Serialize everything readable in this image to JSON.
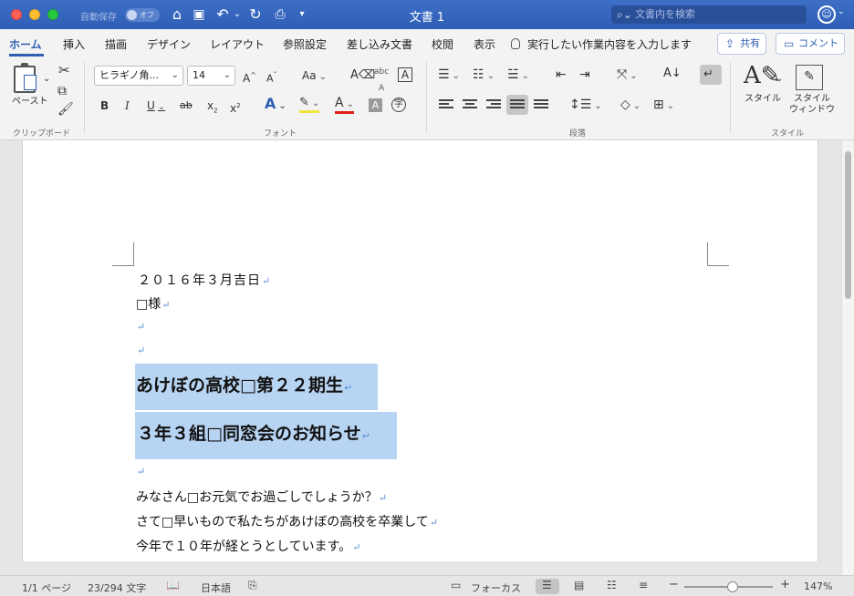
{
  "titlebar": {
    "autosave_label": "自動保存",
    "autosave_state": "オフ",
    "doc_title": "文書 1",
    "search_placeholder": "文書内を検索"
  },
  "tabs": [
    {
      "label": "ホーム",
      "active": true
    },
    {
      "label": "挿入"
    },
    {
      "label": "描画"
    },
    {
      "label": "デザイン"
    },
    {
      "label": "レイアウト"
    },
    {
      "label": "参照設定"
    },
    {
      "label": "差し込み文書"
    },
    {
      "label": "校閲"
    },
    {
      "label": "表示"
    }
  ],
  "tellme": "実行したい作業内容を入力します",
  "share_label": "共有",
  "comment_label": "コメント",
  "ribbon": {
    "paste_label": "ペースト",
    "clipboard_group": "クリップボード",
    "font_group": "フォント",
    "paragraph_group": "段落",
    "styles_group": "スタイル",
    "font_name": "ヒラギノ角...",
    "font_size": "14",
    "styles_label": "スタイル",
    "styles_pane_label_1": "スタイル",
    "styles_pane_label_2": "ウィンドウ",
    "bold": "B",
    "italic": "I",
    "underline": "U",
    "strike": "ab",
    "subscript": "x",
    "superscript": "x",
    "case": "Aa",
    "grow": "A",
    "shrink": "A"
  },
  "document": {
    "lines": [
      "２０１６年３月吉日",
      "□様",
      "",
      ""
    ],
    "heading_1": "あけぼの高校□第２２期生",
    "heading_2": "３年３組□同窓会のお知らせ",
    "body": [
      "",
      "みなさん□お元気でお過ごしでしょうか？",
      "さて□早いもので私たちがあけぼの高校を卒業して",
      "今年で１０年が経とうとしています。"
    ],
    "paragraph_mark": "↵"
  },
  "statusbar": {
    "page": "1/1 ページ",
    "words": "23/294 文字",
    "language": "日本語",
    "focus": "フォーカス",
    "zoom": "147%",
    "zoom_level_fraction": 0.55
  }
}
